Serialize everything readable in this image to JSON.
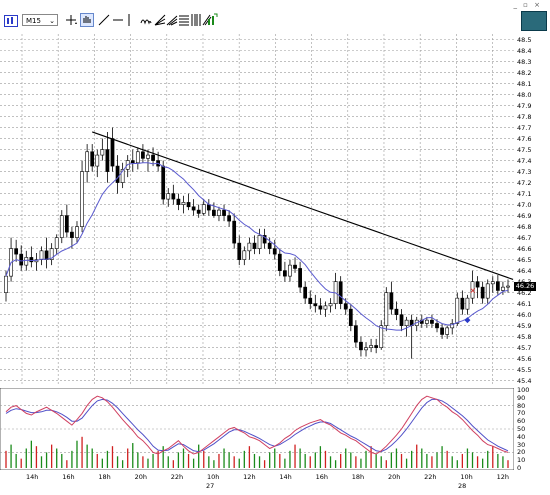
{
  "toolbar": {
    "timeframe": "M15",
    "window_controls": "_ ▫ ×",
    "icons": [
      "chart-type-icon",
      "timeframe-selector",
      "crosshair-icon",
      "hand-icon",
      "line-icon",
      "hline-icon",
      "vline-icon",
      "cycle-icon",
      "fib-fan-icon",
      "pitchfork-icon",
      "channel-icon",
      "fib-icon",
      "gann-icon",
      "signal-icon"
    ]
  },
  "colors": {
    "background": "#ffffff",
    "grid": "#9a9a9a",
    "candle_up": "#ffffff",
    "candle_down": "#000000",
    "moving_average": "#5a5acf",
    "trendline": "#000000",
    "osc_main": "#d04060",
    "osc_signal": "#5050c8",
    "hist_up": "#1a8a1a",
    "hist_down": "#d02020",
    "arrow_sell": "#d02020",
    "arrow_buy": "#2a3ac8"
  },
  "price_axis": {
    "labels": [
      "48.5",
      "48.4",
      "48.3",
      "48.2",
      "48.1",
      "48.0",
      "47.9",
      "47.8",
      "47.7",
      "47.6",
      "47.5",
      "47.4",
      "47.3",
      "47.2",
      "47.1",
      "47.0",
      "46.9",
      "46.8",
      "46.7",
      "46.6",
      "46.5",
      "46.4",
      "46.3",
      "46.2",
      "46.1",
      "46.0",
      "45.9",
      "45.8",
      "45.7",
      "45.6",
      "45.5",
      "45.4"
    ],
    "current_price": "46.26"
  },
  "osc_axis": {
    "labels": [
      "100",
      "90",
      "80",
      "70",
      "60",
      "50",
      "40",
      "30",
      "20",
      "10",
      "0"
    ]
  },
  "time_axis": {
    "labels": [
      "14h",
      "16h",
      "18h",
      "20h",
      "22h",
      "10h",
      "12h",
      "14h",
      "16h",
      "18h",
      "20h",
      "22h",
      "10h",
      "12h"
    ],
    "dates": [
      {
        "text": "27"
      },
      {
        "text": "28"
      }
    ]
  },
  "chart_data": {
    "type": "candlestick",
    "ylim": [
      45.37,
      48.55
    ],
    "osc_ylim": [
      0,
      100
    ],
    "candles": [
      {
        "o": 46.2,
        "h": 46.4,
        "l": 46.12,
        "c": 46.35
      },
      {
        "o": 46.35,
        "h": 46.7,
        "l": 46.3,
        "c": 46.6
      },
      {
        "o": 46.6,
        "h": 46.68,
        "l": 46.48,
        "c": 46.55
      },
      {
        "o": 46.55,
        "h": 46.63,
        "l": 46.4,
        "c": 46.45
      },
      {
        "o": 46.45,
        "h": 46.58,
        "l": 46.4,
        "c": 46.52
      },
      {
        "o": 46.52,
        "h": 46.62,
        "l": 46.43,
        "c": 46.48
      },
      {
        "o": 46.48,
        "h": 46.56,
        "l": 46.4,
        "c": 46.5
      },
      {
        "o": 46.5,
        "h": 46.62,
        "l": 46.45,
        "c": 46.58
      },
      {
        "o": 46.58,
        "h": 46.7,
        "l": 46.42,
        "c": 46.5
      },
      {
        "o": 46.5,
        "h": 46.65,
        "l": 46.45,
        "c": 46.6
      },
      {
        "o": 46.6,
        "h": 46.73,
        "l": 46.55,
        "c": 46.7
      },
      {
        "o": 46.7,
        "h": 46.95,
        "l": 46.65,
        "c": 46.9
      },
      {
        "o": 46.9,
        "h": 47.0,
        "l": 46.7,
        "c": 46.75
      },
      {
        "o": 46.75,
        "h": 46.8,
        "l": 46.6,
        "c": 46.7
      },
      {
        "o": 46.7,
        "h": 46.85,
        "l": 46.65,
        "c": 46.8
      },
      {
        "o": 46.8,
        "h": 47.4,
        "l": 46.75,
        "c": 47.3
      },
      {
        "o": 47.3,
        "h": 47.55,
        "l": 47.2,
        "c": 47.48
      },
      {
        "o": 47.48,
        "h": 47.55,
        "l": 47.3,
        "c": 47.35
      },
      {
        "o": 47.35,
        "h": 47.5,
        "l": 47.25,
        "c": 47.45
      },
      {
        "o": 47.45,
        "h": 47.6,
        "l": 47.4,
        "c": 47.5
      },
      {
        "o": 47.5,
        "h": 47.66,
        "l": 47.2,
        "c": 47.3
      },
      {
        "o": 47.6,
        "h": 47.7,
        "l": 47.3,
        "c": 47.35
      },
      {
        "o": 47.35,
        "h": 47.45,
        "l": 47.1,
        "c": 47.2
      },
      {
        "o": 47.2,
        "h": 47.38,
        "l": 47.15,
        "c": 47.32
      },
      {
        "o": 47.32,
        "h": 47.45,
        "l": 47.25,
        "c": 47.4
      },
      {
        "o": 47.4,
        "h": 47.5,
        "l": 47.3,
        "c": 47.38
      },
      {
        "o": 47.38,
        "h": 47.52,
        "l": 47.32,
        "c": 47.48
      },
      {
        "o": 47.48,
        "h": 47.55,
        "l": 47.38,
        "c": 47.42
      },
      {
        "o": 47.42,
        "h": 47.5,
        "l": 47.3,
        "c": 47.45
      },
      {
        "o": 47.45,
        "h": 47.52,
        "l": 47.35,
        "c": 47.4
      },
      {
        "o": 47.4,
        "h": 47.48,
        "l": 47.3,
        "c": 47.35
      },
      {
        "o": 47.35,
        "h": 47.4,
        "l": 47.0,
        "c": 47.05
      },
      {
        "o": 47.05,
        "h": 47.15,
        "l": 46.98,
        "c": 47.1
      },
      {
        "o": 47.1,
        "h": 47.18,
        "l": 47.0,
        "c": 47.05
      },
      {
        "o": 47.05,
        "h": 47.1,
        "l": 46.95,
        "c": 47.0
      },
      {
        "o": 47.0,
        "h": 47.08,
        "l": 46.92,
        "c": 47.02
      },
      {
        "o": 47.02,
        "h": 47.1,
        "l": 46.95,
        "c": 46.98
      },
      {
        "o": 46.98,
        "h": 47.05,
        "l": 46.9,
        "c": 46.95
      },
      {
        "o": 46.95,
        "h": 47.0,
        "l": 46.88,
        "c": 46.92
      },
      {
        "o": 46.92,
        "h": 47.05,
        "l": 46.9,
        "c": 47.0
      },
      {
        "o": 47.0,
        "h": 47.05,
        "l": 46.9,
        "c": 46.95
      },
      {
        "o": 46.95,
        "h": 47.02,
        "l": 46.88,
        "c": 46.9
      },
      {
        "o": 46.9,
        "h": 46.98,
        "l": 46.85,
        "c": 46.95
      },
      {
        "o": 46.95,
        "h": 47.0,
        "l": 46.85,
        "c": 46.9
      },
      {
        "o": 46.9,
        "h": 46.95,
        "l": 46.8,
        "c": 46.85
      },
      {
        "o": 46.85,
        "h": 46.92,
        "l": 46.6,
        "c": 46.65
      },
      {
        "o": 46.65,
        "h": 46.72,
        "l": 46.45,
        "c": 46.5
      },
      {
        "o": 46.5,
        "h": 46.62,
        "l": 46.45,
        "c": 46.58
      },
      {
        "o": 46.58,
        "h": 46.7,
        "l": 46.5,
        "c": 46.65
      },
      {
        "o": 46.65,
        "h": 46.72,
        "l": 46.55,
        "c": 46.6
      },
      {
        "o": 46.6,
        "h": 46.78,
        "l": 46.55,
        "c": 46.72
      },
      {
        "o": 46.72,
        "h": 46.78,
        "l": 46.6,
        "c": 46.65
      },
      {
        "o": 46.65,
        "h": 46.7,
        "l": 46.55,
        "c": 46.6
      },
      {
        "o": 46.6,
        "h": 46.68,
        "l": 46.5,
        "c": 46.55
      },
      {
        "o": 46.55,
        "h": 46.6,
        "l": 46.35,
        "c": 46.4
      },
      {
        "o": 46.4,
        "h": 46.48,
        "l": 46.3,
        "c": 46.35
      },
      {
        "o": 46.35,
        "h": 46.5,
        "l": 46.3,
        "c": 46.45
      },
      {
        "o": 46.45,
        "h": 46.52,
        "l": 46.38,
        "c": 46.42
      },
      {
        "o": 46.42,
        "h": 46.48,
        "l": 46.2,
        "c": 46.25
      },
      {
        "o": 46.25,
        "h": 46.3,
        "l": 46.1,
        "c": 46.15
      },
      {
        "o": 46.15,
        "h": 46.22,
        "l": 46.05,
        "c": 46.1
      },
      {
        "o": 46.1,
        "h": 46.18,
        "l": 46.02,
        "c": 46.08
      },
      {
        "o": 46.08,
        "h": 46.15,
        "l": 46.0,
        "c": 46.05
      },
      {
        "o": 46.05,
        "h": 46.12,
        "l": 45.98,
        "c": 46.08
      },
      {
        "o": 46.08,
        "h": 46.15,
        "l": 46.02,
        "c": 46.1
      },
      {
        "o": 46.1,
        "h": 46.38,
        "l": 46.05,
        "c": 46.3
      },
      {
        "o": 46.3,
        "h": 46.35,
        "l": 46.05,
        "c": 46.1
      },
      {
        "o": 46.1,
        "h": 46.15,
        "l": 46.0,
        "c": 46.05
      },
      {
        "o": 46.05,
        "h": 46.1,
        "l": 45.85,
        "c": 45.9
      },
      {
        "o": 45.9,
        "h": 45.95,
        "l": 45.7,
        "c": 45.75
      },
      {
        "o": 45.75,
        "h": 45.8,
        "l": 45.62,
        "c": 45.68
      },
      {
        "o": 45.68,
        "h": 45.75,
        "l": 45.62,
        "c": 45.7
      },
      {
        "o": 45.7,
        "h": 45.78,
        "l": 45.66,
        "c": 45.72
      },
      {
        "o": 45.72,
        "h": 45.78,
        "l": 45.65,
        "c": 45.7
      },
      {
        "o": 45.7,
        "h": 45.95,
        "l": 45.68,
        "c": 45.9
      },
      {
        "o": 45.9,
        "h": 46.25,
        "l": 45.85,
        "c": 46.2
      },
      {
        "o": 46.2,
        "h": 46.3,
        "l": 46.0,
        "c": 46.05
      },
      {
        "o": 46.05,
        "h": 46.12,
        "l": 45.95,
        "c": 46.0
      },
      {
        "o": 46.0,
        "h": 46.05,
        "l": 45.85,
        "c": 45.9
      },
      {
        "o": 45.9,
        "h": 45.98,
        "l": 45.8,
        "c": 45.95
      },
      {
        "o": 45.95,
        "h": 46.0,
        "l": 45.6,
        "c": 45.9
      },
      {
        "o": 45.9,
        "h": 45.98,
        "l": 45.85,
        "c": 45.95
      },
      {
        "o": 45.95,
        "h": 46.0,
        "l": 45.88,
        "c": 45.92
      },
      {
        "o": 45.92,
        "h": 45.98,
        "l": 45.88,
        "c": 45.95
      },
      {
        "o": 45.95,
        "h": 46.0,
        "l": 45.88,
        "c": 45.92
      },
      {
        "o": 45.92,
        "h": 45.96,
        "l": 45.84,
        "c": 45.88
      },
      {
        "o": 45.88,
        "h": 45.92,
        "l": 45.78,
        "c": 45.82
      },
      {
        "o": 45.82,
        "h": 45.9,
        "l": 45.78,
        "c": 45.88
      },
      {
        "o": 45.88,
        "h": 45.96,
        "l": 45.82,
        "c": 45.92
      },
      {
        "o": 45.92,
        "h": 46.2,
        "l": 45.9,
        "c": 46.15
      },
      {
        "o": 46.15,
        "h": 46.22,
        "l": 46.0,
        "c": 46.05
      },
      {
        "o": 46.05,
        "h": 46.18,
        "l": 46.0,
        "c": 46.15
      },
      {
        "o": 46.15,
        "h": 46.4,
        "l": 46.1,
        "c": 46.3
      },
      {
        "o": 46.3,
        "h": 46.35,
        "l": 46.15,
        "c": 46.25
      },
      {
        "o": 46.25,
        "h": 46.3,
        "l": 46.1,
        "c": 46.15
      },
      {
        "o": 46.15,
        "h": 46.32,
        "l": 46.1,
        "c": 46.28
      },
      {
        "o": 46.28,
        "h": 46.35,
        "l": 46.2,
        "c": 46.3
      },
      {
        "o": 46.3,
        "h": 46.36,
        "l": 46.18,
        "c": 46.22
      },
      {
        "o": 46.22,
        "h": 46.3,
        "l": 46.18,
        "c": 46.25
      },
      {
        "o": 46.25,
        "h": 46.32,
        "l": 46.2,
        "c": 46.26
      }
    ],
    "ma_period": 10,
    "trendline": {
      "from": {
        "bar": 17,
        "price": 47.66
      },
      "to": {
        "bar": 100,
        "price": 46.32
      }
    },
    "markers": [
      {
        "type": "sell",
        "bar": 92,
        "price": 46.22
      },
      {
        "type": "buy",
        "bar": 91,
        "price": 45.95
      }
    ],
    "oscillator": {
      "main": [
        72,
        78,
        80,
        75,
        70,
        68,
        72,
        75,
        78,
        74,
        70,
        65,
        60,
        55,
        62,
        70,
        80,
        88,
        92,
        90,
        85,
        78,
        70,
        62,
        55,
        48,
        40,
        35,
        28,
        20,
        18,
        22,
        25,
        30,
        35,
        28,
        22,
        18,
        20,
        25,
        30,
        35,
        40,
        45,
        50,
        52,
        48,
        45,
        40,
        38,
        35,
        30,
        25,
        28,
        32,
        38,
        42,
        48,
        52,
        55,
        58,
        60,
        62,
        58,
        55,
        50,
        45,
        42,
        38,
        35,
        30,
        25,
        20,
        18,
        22,
        28,
        35,
        42,
        50,
        60,
        70,
        80,
        88,
        92,
        90,
        88,
        82,
        78,
        72,
        68,
        62,
        55,
        48,
        42,
        35,
        30,
        28,
        25,
        22,
        20
      ],
      "signal": [
        70,
        74,
        76,
        75,
        73,
        71,
        71,
        72,
        74,
        74,
        72,
        69,
        65,
        60,
        60,
        64,
        72,
        80,
        86,
        88,
        87,
        83,
        77,
        70,
        63,
        56,
        49,
        43,
        36,
        28,
        23,
        22,
        23,
        27,
        31,
        30,
        26,
        22,
        21,
        23,
        27,
        31,
        36,
        41,
        46,
        49,
        49,
        47,
        44,
        41,
        38,
        34,
        30,
        28,
        30,
        34,
        38,
        43,
        47,
        51,
        54,
        57,
        59,
        59,
        57,
        53,
        49,
        45,
        41,
        38,
        34,
        30,
        26,
        22,
        21,
        24,
        29,
        35,
        42,
        50,
        59,
        68,
        77,
        84,
        88,
        88,
        86,
        82,
        77,
        72,
        67,
        61,
        54,
        48,
        42,
        36,
        32,
        28,
        25,
        22
      ],
      "histogram": [
        22,
        30,
        18,
        12,
        25,
        35,
        28,
        15,
        20,
        30,
        25,
        18,
        10,
        22,
        35,
        40,
        30,
        25,
        18,
        12,
        22,
        28,
        15,
        10,
        25,
        32,
        20,
        15,
        12,
        18,
        22,
        28,
        15,
        10,
        20,
        25,
        18,
        12,
        30,
        22,
        15,
        10,
        18,
        25,
        20,
        15,
        12,
        22,
        28,
        18,
        15,
        10,
        20,
        25,
        18,
        12,
        22,
        30,
        25,
        18,
        15,
        20,
        28,
        22,
        15,
        10,
        18,
        25,
        20,
        15,
        12,
        22,
        28,
        18,
        15,
        10,
        20,
        25,
        18,
        12,
        22,
        30,
        25,
        18,
        15,
        20,
        28,
        22,
        15,
        10,
        18,
        25,
        20,
        15,
        12,
        22,
        28,
        18,
        15,
        10
      ]
    }
  }
}
